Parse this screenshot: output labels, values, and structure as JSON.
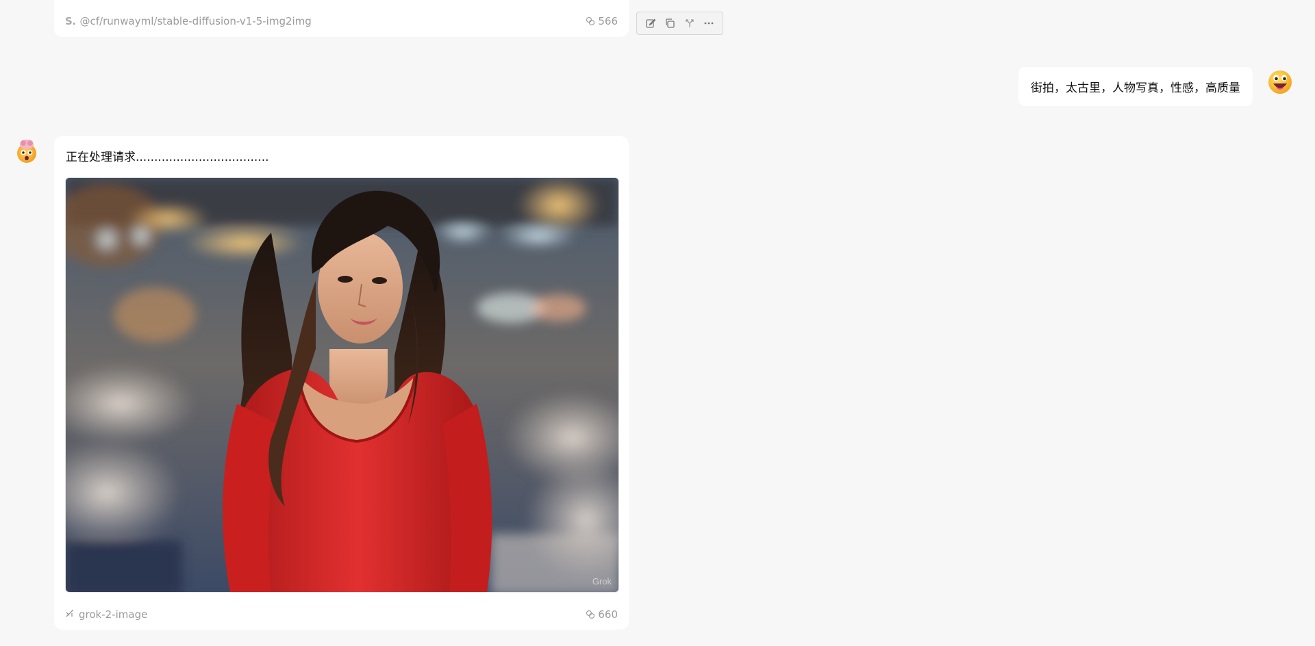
{
  "previous_message": {
    "model_name": "@cf/runwayml/stable-diffusion-v1-5-img2img",
    "model_logo_text": "S.",
    "token_count": "566"
  },
  "toolbar": {
    "actions": [
      "edit-icon",
      "copy-icon",
      "branch-icon",
      "more-icon"
    ]
  },
  "user_message": {
    "text": "街拍，太古里，人物写真，性感，高质量"
  },
  "assistant_message": {
    "text": "正在处理请求....................................",
    "image_alt": "生成的人物写真",
    "watermark": "Grok",
    "model_name": "grok-2-image",
    "token_count": "660"
  },
  "colors": {
    "background": "#f7f7f7",
    "card": "#ffffff",
    "muted_text": "#9a9a9a",
    "dress_red": "#d92a2a"
  }
}
